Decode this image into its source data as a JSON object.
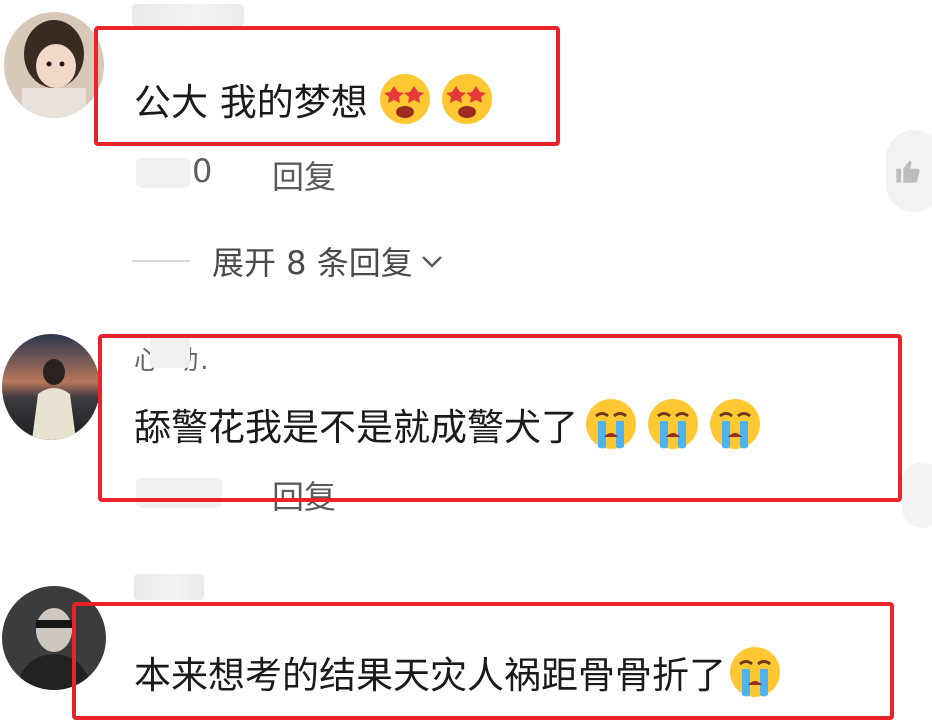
{
  "comments": [
    {
      "text": "公大 我的梦想",
      "emojis": [
        "star-eyes-emoji",
        "star-eyes-emoji"
      ],
      "time_suffix": "0",
      "reply_label": "回复",
      "expand_label": "展开 8 条回复"
    },
    {
      "name_fragment": "心 动.",
      "text": "舔警花我是不是就成警犬了",
      "emojis": [
        "crying-emoji",
        "crying-emoji",
        "crying-emoji"
      ],
      "reply_label": "回复"
    },
    {
      "text": "本来想考的结果天灾人祸距骨骨折了",
      "emojis": [
        "crying-emoji"
      ]
    }
  ],
  "colors": {
    "highlight_box": "#e8232a",
    "emoji_face": "#ffc832",
    "tear_blue": "#4fb2f0"
  }
}
